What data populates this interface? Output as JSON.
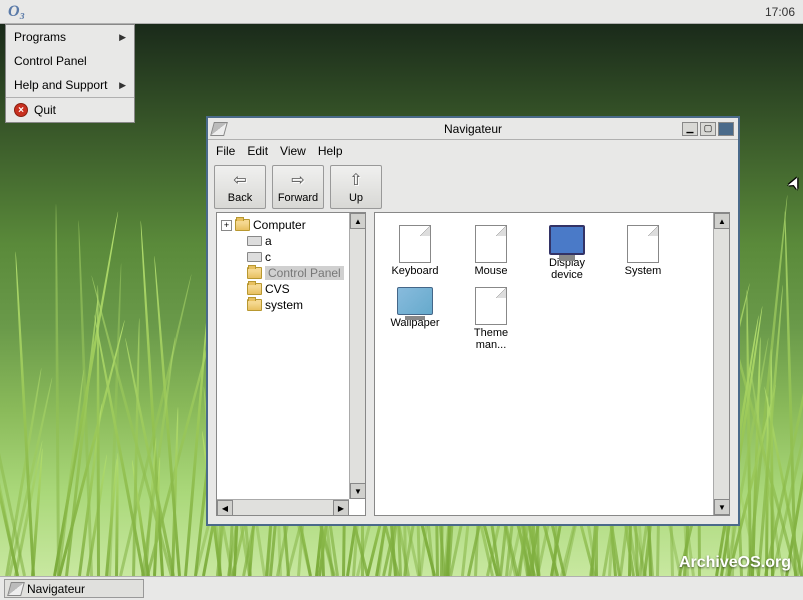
{
  "menubar": {
    "logo": "O₃",
    "clock": "17:06"
  },
  "start_menu": {
    "items": [
      {
        "label": "Programs",
        "arrow": true
      },
      {
        "label": "Control Panel",
        "arrow": false
      },
      {
        "label": "Help and Support",
        "arrow": true
      }
    ],
    "quit_label": "Quit"
  },
  "window": {
    "title": "Navigateur",
    "menus": {
      "file": "File",
      "edit": "Edit",
      "view": "View",
      "help": "Help"
    },
    "toolbar": {
      "back": "Back",
      "forward": "Forward",
      "up": "Up"
    },
    "tree": {
      "root": "Computer",
      "children": [
        {
          "label": "a",
          "type": "drive"
        },
        {
          "label": "c",
          "type": "drive"
        },
        {
          "label": "Control Panel",
          "type": "folder",
          "selected": true
        },
        {
          "label": "CVS",
          "type": "folder"
        },
        {
          "label": "system",
          "type": "folder"
        }
      ]
    },
    "icons": [
      {
        "label": "Keyboard",
        "type": "doc"
      },
      {
        "label": "Mouse",
        "type": "doc"
      },
      {
        "label": "Display device",
        "type": "monitor"
      },
      {
        "label": "System",
        "type": "doc"
      },
      {
        "label": "Wallpaper",
        "type": "screen"
      },
      {
        "label": "Theme man...",
        "type": "doc"
      }
    ]
  },
  "taskbar": {
    "task": "Navigateur"
  },
  "watermark": "ArchiveOS.org"
}
